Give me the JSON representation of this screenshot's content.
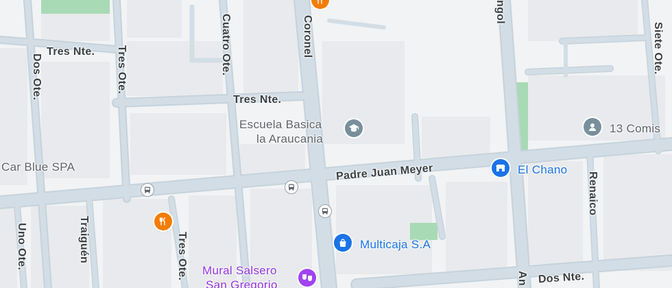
{
  "colors": {
    "background": "#f1f3f4",
    "road": "#d3dde5",
    "road_edge": "#c6d2dc",
    "block": "#e8eaed",
    "park": "#a8dab5",
    "school_icon": "#78909c",
    "restaurant_icon": "#f57c00",
    "shop_icon": "#1a73e8",
    "arts_icon": "#a142f4",
    "bus_icon": "#5f6368"
  },
  "streets": {
    "tres_nte_a": "Tres Nte.",
    "tres_nte_b": "Tres Nte.",
    "dos_nte": "Dos Nte.",
    "padre_juan_meyer": "Padre Juan Meyer",
    "coronel": "Coronel",
    "cuatro_ote": "Cuatro Ote.",
    "tres_ote_top": "Tres Ote.",
    "tres_ote_bottom": "Tres Ote.",
    "dos_ote": "Dos Ote.",
    "uno_ote": "Uno Ote.",
    "traiguen": "Traiguén",
    "siete_ote": "Siete Ote.",
    "renaico": "Renaico",
    "angol_top": "ngol",
    "angol_bottom": "An"
  },
  "places": {
    "school_line1": "Escuela Basica",
    "school_line2": "la Araucania",
    "el_chano": "El Chano",
    "multicaja": "Multicaja S.A",
    "mural_line1": "Mural Salsero",
    "mural_line2": "San Gregorio",
    "car_blue": "Car Blue SPA",
    "comisaria": "13 Comis"
  },
  "icons": [
    "school-icon",
    "restaurant-icon",
    "shop-icon",
    "arts-icon",
    "bus-stop-icon",
    "police-icon"
  ]
}
